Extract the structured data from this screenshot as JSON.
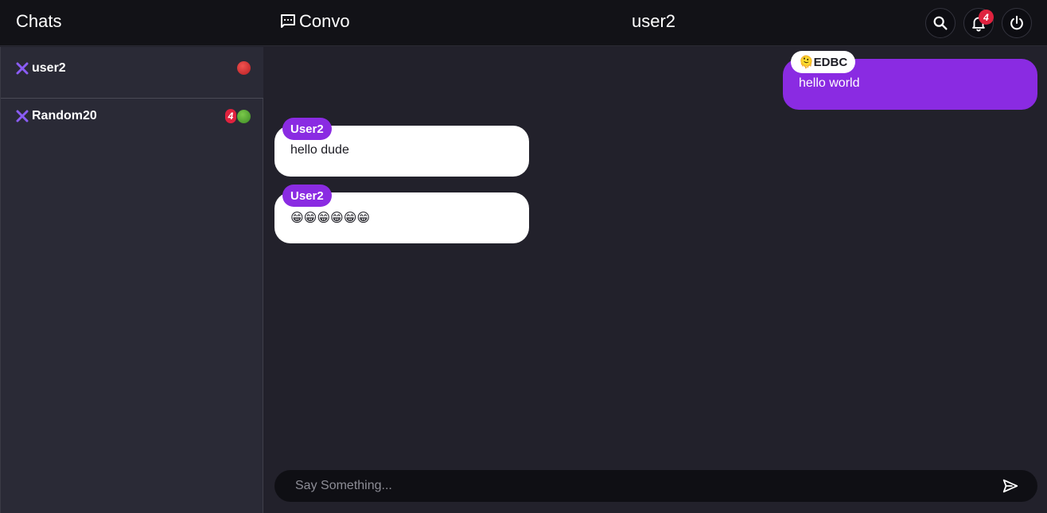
{
  "header": {
    "chats_title": "Chats",
    "brand_name": "Convo",
    "chat_title": "user2",
    "notification_count": "4"
  },
  "sidebar": {
    "contacts": [
      {
        "name": "user2",
        "status": "offline",
        "unread": ""
      },
      {
        "name": "Random20",
        "status": "online",
        "unread": "4"
      }
    ]
  },
  "messages": [
    {
      "sender": "🫠EDBC",
      "text": "hello world",
      "own": true
    },
    {
      "sender": "User2",
      "text": "hello dude",
      "own": false
    },
    {
      "sender": "User2",
      "text": "😁😁😁😁😁😁",
      "own": false
    }
  ],
  "composer": {
    "placeholder": "Say Something...",
    "value": ""
  },
  "colors": {
    "accent": "#8a2be2",
    "header_bg": "#121217",
    "sidebar_bg": "#2a2a36",
    "chat_bg": "#22212b",
    "badge_red": "#e0223e",
    "status_offline": "#d0302c",
    "status_online": "#5aa83a"
  },
  "icons": {
    "brand": "chat-bubble-icon",
    "search": "search-icon",
    "notifications": "bell-icon",
    "logout": "power-icon",
    "contact": "close-x-icon",
    "send": "send-icon"
  }
}
